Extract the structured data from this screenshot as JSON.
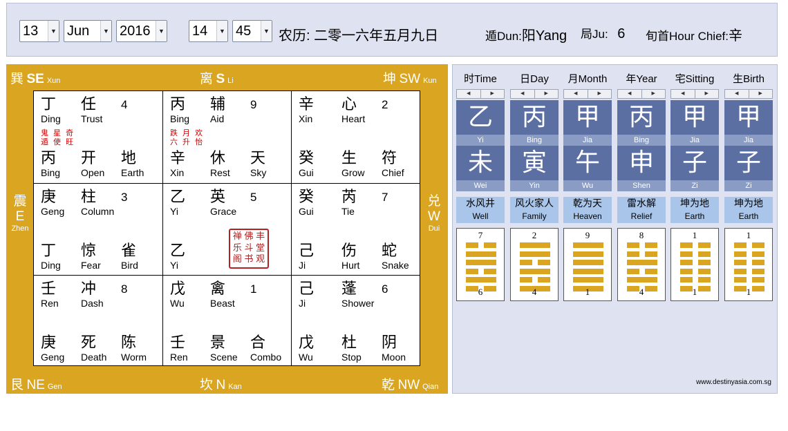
{
  "toolbar": {
    "day": "13",
    "month": "Jun",
    "year": "2016",
    "hour": "14",
    "minute": "45",
    "lunar": "农历: 二零一六年五月九日",
    "dun_label": "遁Dun:",
    "dun_value": "阳Yang",
    "ju_label": "局Ju:",
    "ju_value": "6",
    "chief_label": "旬首Hour Chief:",
    "chief_value": "辛"
  },
  "directions": {
    "se": {
      "zh": "巽",
      "code": "SE",
      "en": "Xun"
    },
    "s": {
      "zh": "离",
      "code": "S",
      "en": "Li"
    },
    "sw": {
      "zh": "坤",
      "code": "SW",
      "en": "Kun"
    },
    "e": {
      "zh": "震",
      "code": "E",
      "en": "Zhen"
    },
    "w": {
      "zh": "兑",
      "code": "W",
      "en": "Dui"
    },
    "ne": {
      "zh": "艮",
      "code": "NE",
      "en": "Gen"
    },
    "n": {
      "zh": "坎",
      "code": "N",
      "en": "Kan"
    },
    "nw": {
      "zh": "乾",
      "code": "NW",
      "en": "Qian"
    }
  },
  "palaces": [
    {
      "tl": {
        "zh": "丁",
        "en": "Ding"
      },
      "tm": {
        "zh": "任",
        "en": "Trust"
      },
      "num": "4",
      "red": [
        "鬼 星 奇",
        "遁 使 旺"
      ],
      "bl": {
        "zh": "丙",
        "en": "Bing"
      },
      "bm": {
        "zh": "开",
        "en": "Open"
      },
      "br": {
        "zh": "地",
        "en": "Earth"
      }
    },
    {
      "tl": {
        "zh": "丙",
        "en": "Bing"
      },
      "tm": {
        "zh": "辅",
        "en": "Aid"
      },
      "num": "9",
      "red": [
        "跌 月 欢",
        "六 升 怡"
      ],
      "bl": {
        "zh": "辛",
        "en": "Xin"
      },
      "bm": {
        "zh": "休",
        "en": "Rest"
      },
      "br": {
        "zh": "天",
        "en": "Sky"
      }
    },
    {
      "tl": {
        "zh": "辛",
        "en": "Xin"
      },
      "tm": {
        "zh": "心",
        "en": "Heart"
      },
      "num": "2",
      "red": [],
      "bl": {
        "zh": "癸",
        "en": "Gui"
      },
      "bm": {
        "zh": "生",
        "en": "Grow"
      },
      "br": {
        "zh": "符",
        "en": "Chief"
      }
    },
    {
      "tl": {
        "zh": "庚",
        "en": "Geng"
      },
      "tm": {
        "zh": "柱",
        "en": "Column"
      },
      "num": "3",
      "red": [],
      "bl": {
        "zh": "丁",
        "en": "Ding"
      },
      "bm": {
        "zh": "惊",
        "en": "Fear"
      },
      "br": {
        "zh": "雀",
        "en": "Bird"
      }
    },
    {
      "tl": {
        "zh": "乙",
        "en": "Yi"
      },
      "tm": {
        "zh": "英",
        "en": "Grace"
      },
      "num": "5",
      "red": [],
      "bl": {
        "zh": "乙",
        "en": "Yi"
      },
      "bm": {
        "zh": "",
        "en": ""
      },
      "br": {
        "zh": "",
        "en": ""
      }
    },
    {
      "tl": {
        "zh": "癸",
        "en": "Gui"
      },
      "tm": {
        "zh": "芮",
        "en": "Tie"
      },
      "num": "7",
      "red": [],
      "bl": {
        "zh": "己",
        "en": "Ji"
      },
      "bm": {
        "zh": "伤",
        "en": "Hurt"
      },
      "br": {
        "zh": "蛇",
        "en": "Snake"
      }
    },
    {
      "tl": {
        "zh": "壬",
        "en": "Ren"
      },
      "tm": {
        "zh": "冲",
        "en": "Dash"
      },
      "num": "8",
      "red": [],
      "bl": {
        "zh": "庚",
        "en": "Geng"
      },
      "bm": {
        "zh": "死",
        "en": "Death"
      },
      "br": {
        "zh": "陈",
        "en": "Worm"
      }
    },
    {
      "tl": {
        "zh": "戊",
        "en": "Wu"
      },
      "tm": {
        "zh": "禽",
        "en": "Beast"
      },
      "num": "1",
      "red": [],
      "bl": {
        "zh": "壬",
        "en": "Ren"
      },
      "bm": {
        "zh": "景",
        "en": "Scene"
      },
      "br": {
        "zh": "合",
        "en": "Combo"
      }
    },
    {
      "tl": {
        "zh": "己",
        "en": "Ji"
      },
      "tm": {
        "zh": "蓬",
        "en": "Shower"
      },
      "num": "6",
      "red": [],
      "bl": {
        "zh": "戊",
        "en": "Wu"
      },
      "bm": {
        "zh": "杜",
        "en": "Stop"
      },
      "br": {
        "zh": "阴",
        "en": "Moon"
      }
    }
  ],
  "stamp_chars": [
    "禅",
    "佛",
    "丰",
    "乐",
    "斗",
    "堂",
    "阁",
    "书",
    "观"
  ],
  "pillars": [
    {
      "head": "时Time",
      "stem_zh": "乙",
      "stem_en": "Yi",
      "branch_zh": "未",
      "branch_en": "Wei",
      "hex_zh": "水风井",
      "hex_en": "Well",
      "top": "7",
      "bottom": "6",
      "lines": [
        0,
        1,
        1,
        0,
        1,
        0
      ]
    },
    {
      "head": "日Day",
      "stem_zh": "丙",
      "stem_en": "Bing",
      "branch_zh": "寅",
      "branch_en": "Yin",
      "hex_zh": "风火家人",
      "hex_en": "Family",
      "top": "2",
      "bottom": "4",
      "lines": [
        1,
        1,
        0,
        1,
        0,
        1
      ]
    },
    {
      "head": "月Month",
      "stem_zh": "甲",
      "stem_en": "Jia",
      "branch_zh": "午",
      "branch_en": "Wu",
      "hex_zh": "乾为天",
      "hex_en": "Heaven",
      "top": "9",
      "bottom": "1",
      "lines": [
        1,
        1,
        1,
        1,
        1,
        1
      ]
    },
    {
      "head": "年Year",
      "stem_zh": "丙",
      "stem_en": "Bing",
      "branch_zh": "申",
      "branch_en": "Shen",
      "hex_zh": "雷水解",
      "hex_en": "Relief",
      "top": "8",
      "bottom": "4",
      "lines": [
        0,
        0,
        1,
        0,
        1,
        0
      ]
    },
    {
      "head": "宅Sitting",
      "stem_zh": "甲",
      "stem_en": "Jia",
      "branch_zh": "子",
      "branch_en": "Zi",
      "hex_zh": "坤为地",
      "hex_en": "Earth",
      "top": "1",
      "bottom": "1",
      "lines": [
        0,
        0,
        0,
        0,
        0,
        0
      ]
    },
    {
      "head": "生Birth",
      "stem_zh": "甲",
      "stem_en": "Jia",
      "branch_zh": "子",
      "branch_en": "Zi",
      "hex_zh": "坤为地",
      "hex_en": "Earth",
      "top": "1",
      "bottom": "1",
      "lines": [
        0,
        0,
        0,
        0,
        0,
        0
      ]
    }
  ],
  "credit": "www.destinyasia.com.sg"
}
